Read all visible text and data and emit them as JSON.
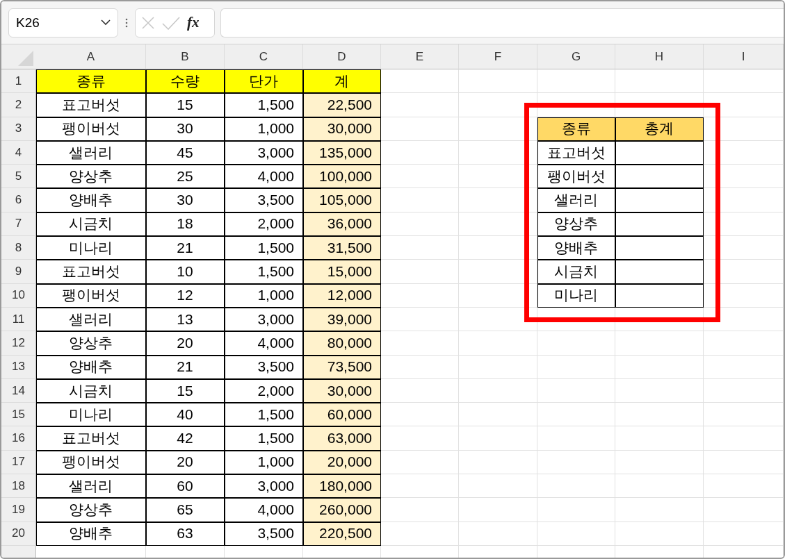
{
  "name_box": {
    "value": "K26"
  },
  "formula_bar": {
    "function_label": "fx"
  },
  "columns": [
    "A",
    "B",
    "C",
    "D",
    "E",
    "F",
    "G",
    "H",
    "I"
  ],
  "row_numbers": [
    "1",
    "2",
    "3",
    "4",
    "5",
    "6",
    "7",
    "8",
    "9",
    "10",
    "11",
    "12",
    "13",
    "14",
    "15",
    "16",
    "17",
    "18",
    "19",
    "20"
  ],
  "table": {
    "header": [
      "종류",
      "수량",
      "단가",
      "계"
    ],
    "rows": [
      [
        "표고버섯",
        "15",
        "1,500",
        "22,500"
      ],
      [
        "팽이버섯",
        "30",
        "1,000",
        "30,000"
      ],
      [
        "샐러리",
        "45",
        "3,000",
        "135,000"
      ],
      [
        "양상추",
        "25",
        "4,000",
        "100,000"
      ],
      [
        "양배추",
        "30",
        "3,500",
        "105,000"
      ],
      [
        "시금치",
        "18",
        "2,000",
        "36,000"
      ],
      [
        "미나리",
        "21",
        "1,500",
        "31,500"
      ],
      [
        "표고버섯",
        "10",
        "1,500",
        "15,000"
      ],
      [
        "팽이버섯",
        "12",
        "1,000",
        "12,000"
      ],
      [
        "샐러리",
        "13",
        "3,000",
        "39,000"
      ],
      [
        "양상추",
        "20",
        "4,000",
        "80,000"
      ],
      [
        "양배추",
        "21",
        "3,500",
        "73,500"
      ],
      [
        "시금치",
        "15",
        "2,000",
        "30,000"
      ],
      [
        "미나리",
        "40",
        "1,500",
        "60,000"
      ],
      [
        "표고버섯",
        "42",
        "1,500",
        "63,000"
      ],
      [
        "팽이버섯",
        "20",
        "1,000",
        "20,000"
      ],
      [
        "샐러리",
        "60",
        "3,000",
        "180,000"
      ],
      [
        "양상추",
        "65",
        "4,000",
        "260,000"
      ],
      [
        "양배추",
        "63",
        "3,500",
        "220,500"
      ]
    ]
  },
  "summary": {
    "header": [
      "종류",
      "총계"
    ],
    "items": [
      "표고버섯",
      "팽이버섯",
      "샐러리",
      "양상추",
      "양배추",
      "시금치",
      "미나리"
    ]
  }
}
